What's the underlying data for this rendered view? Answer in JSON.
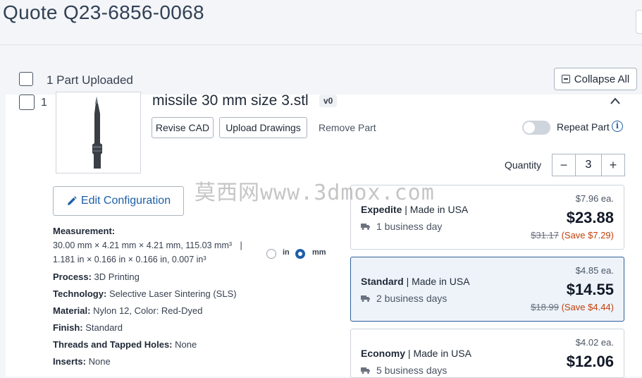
{
  "header": {
    "title": "Quote Q23-6856-0068"
  },
  "toolbar": {
    "uploaded_label": "1 Part Uploaded",
    "collapse_label": "Collapse All"
  },
  "part": {
    "index": "1",
    "name": "missile 30 mm size 3.stl",
    "version": "v0",
    "buttons": {
      "revise_cad": "Revise CAD",
      "upload_drawings": "Upload Drawings",
      "remove_part": "Remove Part"
    },
    "repeat_part_label": "Repeat Part",
    "repeat_part_on": false,
    "quantity_label": "Quantity",
    "quantity": "3",
    "edit_config_label": "Edit Configuration"
  },
  "specs": {
    "measurement_key": "Measurement:",
    "measurement_mm": "30.00 mm × 4.21 mm × 4.21 mm, 115.03 mm³",
    "measurement_sep": "|",
    "measurement_in": "1.181 in × 0.166 in × 0.166 in, 0.007 in³",
    "units": {
      "in": "in",
      "mm": "mm",
      "selected": "mm"
    },
    "process_key": "Process:",
    "process": "3D Printing",
    "technology_key": "Technology:",
    "technology": "Selective Laser Sintering (SLS)",
    "material_key": "Material:",
    "material": "Nylon 12, Color: Red-Dyed",
    "finish_key": "Finish:",
    "finish": "Standard",
    "threads_key": "Threads and Tapped Holes:",
    "threads": "None",
    "inserts_key": "Inserts:",
    "inserts": "None"
  },
  "pricing": [
    {
      "tier": "Expedite",
      "origin": "Made in USA",
      "delivery": "1 business day",
      "unit_price": "$7.96 ea.",
      "total": "$23.88",
      "original": "$31.17",
      "save": "(Save $7.29)",
      "selected": false
    },
    {
      "tier": "Standard",
      "origin": "Made in USA",
      "delivery": "2 business days",
      "unit_price": "$4.85 ea.",
      "total": "$14.55",
      "original": "$18.99",
      "save": "(Save $4.44)",
      "selected": true
    },
    {
      "tier": "Economy",
      "origin": "Made in USA",
      "delivery": "5 business days",
      "unit_price": "$4.02 ea.",
      "total": "$12.06",
      "original": "",
      "save": "",
      "selected": false
    }
  ],
  "watermark": "莫西网www.3dmox.com",
  "colors": {
    "accent": "#1d5fa8",
    "save": "#c2410c",
    "selected_border": "#2b5f99"
  },
  "icons": {
    "edit": "pencil-icon",
    "info": "info-icon",
    "truck": "truck-icon",
    "collapse": "collapse-icon",
    "caret": "chevron-up-icon"
  }
}
